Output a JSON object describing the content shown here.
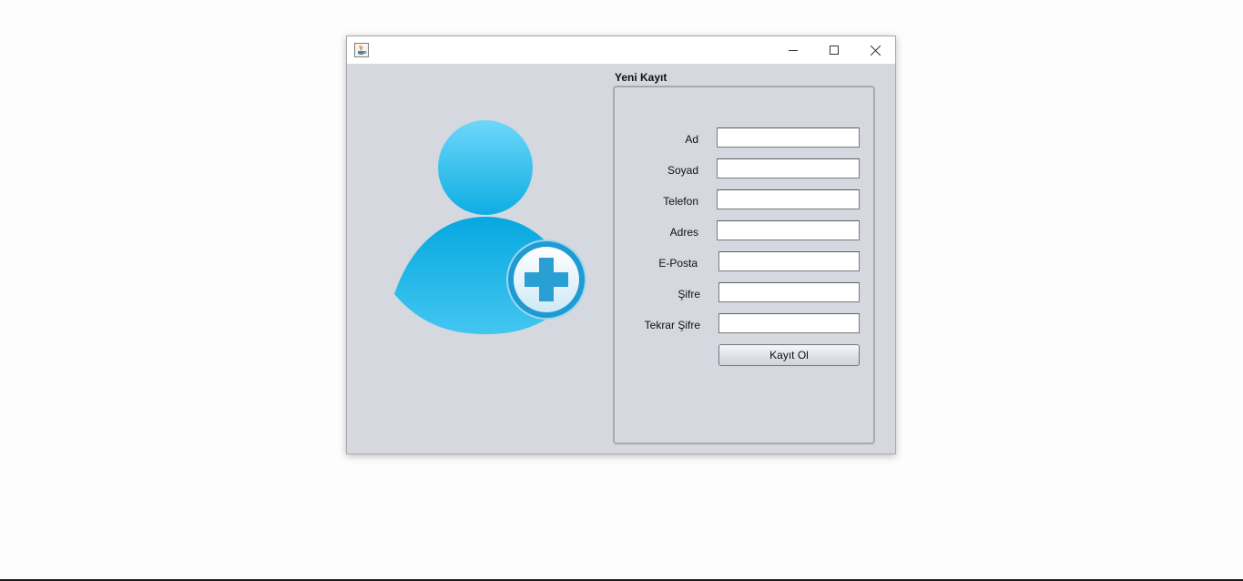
{
  "window": {
    "title": "",
    "app_icon": "java-cup-icon",
    "controls": {
      "minimize_icon": "minimize-icon",
      "maximize_icon": "maximize-icon",
      "close_icon": "close-icon"
    }
  },
  "illustration": {
    "icon": "add-user-icon",
    "colors": {
      "person_light": "#6ed6fa",
      "person_dark": "#06a8e0",
      "plus": "#2a9fd4"
    }
  },
  "form": {
    "group_title": "Yeni Kayıt",
    "fields": [
      {
        "label": "Ad",
        "value": "",
        "placeholder": ""
      },
      {
        "label": "Soyad",
        "value": "",
        "placeholder": ""
      },
      {
        "label": "Telefon",
        "value": "",
        "placeholder": ""
      },
      {
        "label": "Adres",
        "value": "",
        "placeholder": ""
      },
      {
        "label": "E-Posta",
        "value": "",
        "placeholder": ""
      },
      {
        "label": "Şifre",
        "value": "",
        "placeholder": ""
      },
      {
        "label": "Tekrar Şifre",
        "value": "",
        "placeholder": ""
      }
    ],
    "submit_label": "Kayıt Ol"
  }
}
